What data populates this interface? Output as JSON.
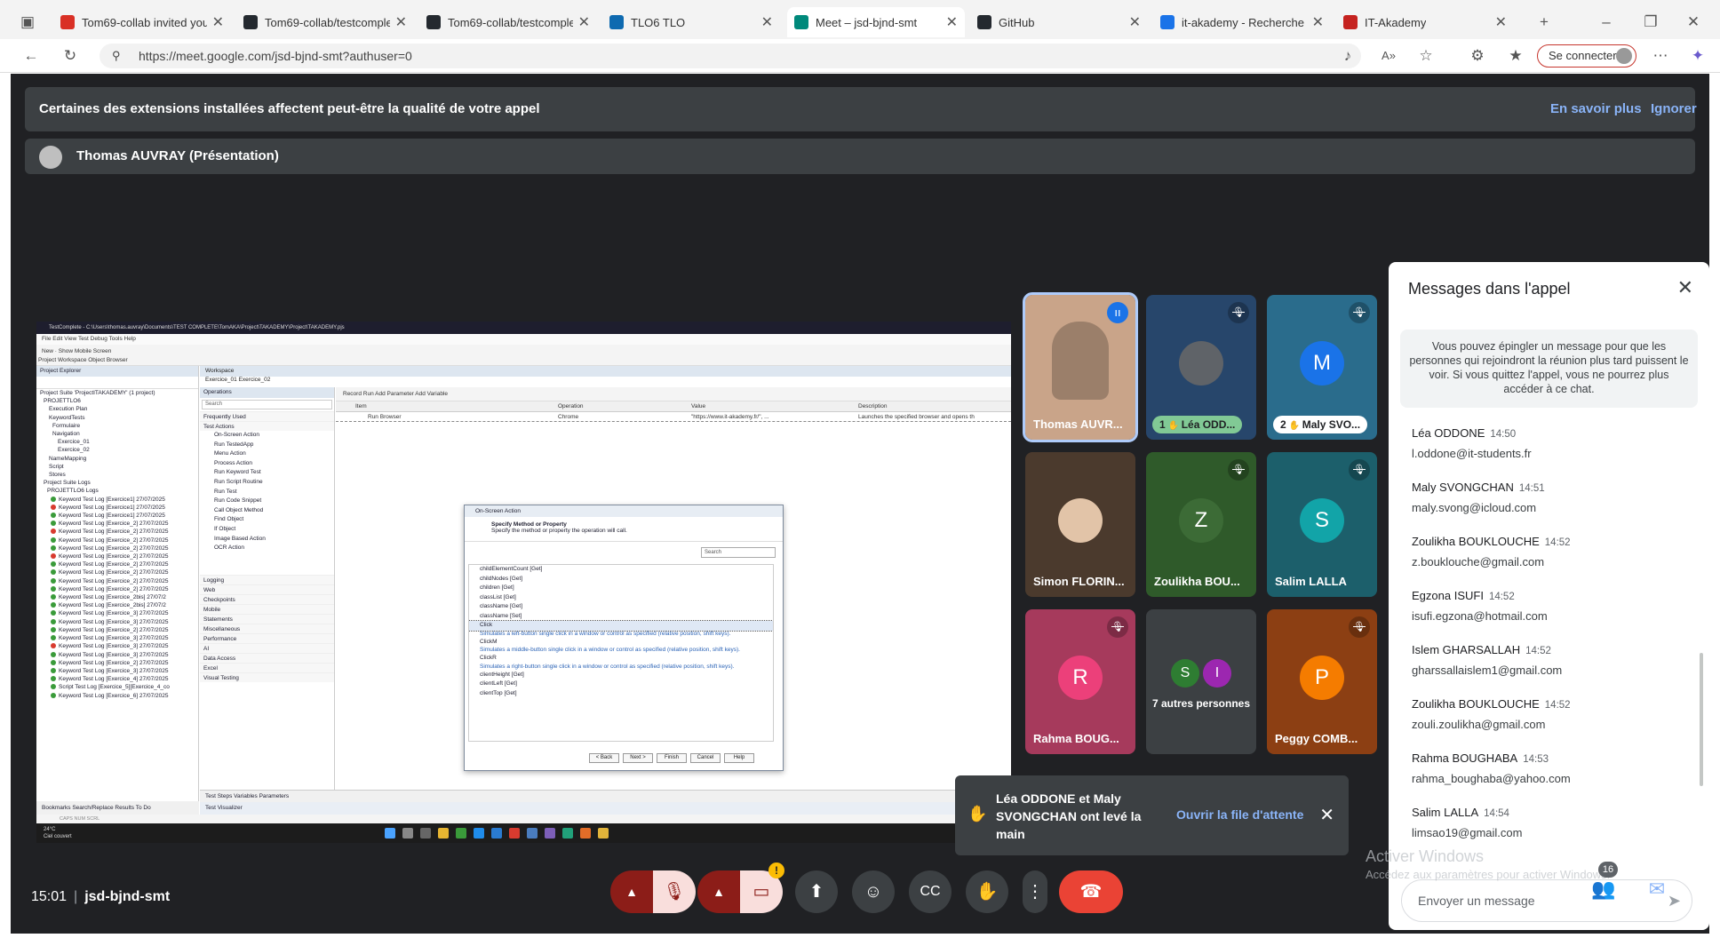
{
  "browser": {
    "tabs": [
      {
        "label": "Tom69-collab invited you t",
        "color": "#d93025"
      },
      {
        "label": "Tom69-collab/testcomplete",
        "color": "#24292f"
      },
      {
        "label": "Tom69-collab/testcomplete",
        "color": "#24292f"
      },
      {
        "label": "TLO6 TLO",
        "color": "#0e6ab0"
      },
      {
        "label": "Meet – jsd-bjnd-smt",
        "color": "#00897b"
      },
      {
        "label": "GitHub",
        "color": "#24292f"
      },
      {
        "label": "it-akademy - Recherche",
        "color": "#1a73e8"
      },
      {
        "label": "IT-Akademy",
        "color": "#c5221f"
      }
    ],
    "url": "https://meet.google.com/jsd-bjnd-smt?authuser=0",
    "connect_label": "Se connecter"
  },
  "banner": {
    "text": "Certaines des extensions installées affectent peut-être la qualité de votre appel",
    "learn_more": "En savoir plus",
    "ignore": "Ignorer"
  },
  "presenter": "Thomas AUVRAY (Présentation)",
  "shared_screen": {
    "window_title": "TestComplete - C:\\Users\\thomas.auvray\\Documents\\TEST COMPLETE\\TomAKA\\Project\\TAKADEMY\\Project\\TAKADEMY.pjs",
    "menu": "File  Edit  View  Test  Debug  Tools  Help",
    "toolbar": "New  ·  Show Mobile Screen",
    "tabs": "Project Workspace   Object Browser",
    "explorer_title": "Project Explorer",
    "workspace_title": "Workspace",
    "tree": [
      {
        "t": "Project Suite 'ProjectITAKADEMY' (1 project)",
        "s": "n"
      },
      {
        "t": "PROJETTLO6",
        "s": "n"
      },
      {
        "t": "Execution Plan",
        "s": "n"
      },
      {
        "t": "KeywordTests",
        "s": "n"
      },
      {
        "t": "Formulaire",
        "s": "n"
      },
      {
        "t": "Navigation",
        "s": "n"
      },
      {
        "t": "Exercice_01",
        "s": "n"
      },
      {
        "t": "Exercice_02",
        "s": "n"
      },
      {
        "t": "NameMapping",
        "s": "n"
      },
      {
        "t": "Script",
        "s": "n"
      },
      {
        "t": "Stores",
        "s": "n"
      },
      {
        "t": "Project Suite Logs",
        "s": "n"
      },
      {
        "t": "PROJETTLO6 Logs",
        "s": "n"
      },
      {
        "t": "Keyword Test Log [Exercice1] 27/07/2025",
        "s": "g"
      },
      {
        "t": "Keyword Test Log [Exercice1] 27/07/2025",
        "s": "r"
      },
      {
        "t": "Keyword Test Log [Exercice1] 27/07/2025",
        "s": "g"
      },
      {
        "t": "Keyword Test Log [Exercice_2] 27/07/2025",
        "s": "g"
      },
      {
        "t": "Keyword Test Log [Exercice_2] 27/07/2025",
        "s": "r"
      },
      {
        "t": "Keyword Test Log [Exercice_2] 27/07/2025",
        "s": "g"
      },
      {
        "t": "Keyword Test Log [Exercice_2] 27/07/2025",
        "s": "g"
      },
      {
        "t": "Keyword Test Log [Exercice_2] 27/07/2025",
        "s": "r"
      },
      {
        "t": "Keyword Test Log [Exercice_2] 27/07/2025",
        "s": "g"
      },
      {
        "t": "Keyword Test Log [Exercice_2] 27/07/2025",
        "s": "g"
      },
      {
        "t": "Keyword Test Log [Exercice_2] 27/07/2025",
        "s": "g"
      },
      {
        "t": "Keyword Test Log [Exercice_2] 27/07/2025",
        "s": "g"
      },
      {
        "t": "Keyword Test Log [Exercice_2bis] 27/07/2",
        "s": "g"
      },
      {
        "t": "Keyword Test Log [Exercice_2bis] 27/07/2",
        "s": "g"
      },
      {
        "t": "Keyword Test Log [Exercice_3] 27/07/2025",
        "s": "g"
      },
      {
        "t": "Keyword Test Log [Exercice_3] 27/07/2025",
        "s": "g"
      },
      {
        "t": "Keyword Test Log [Exercice_2] 27/07/2025",
        "s": "g"
      },
      {
        "t": "Keyword Test Log [Exercice_3] 27/07/2025",
        "s": "g"
      },
      {
        "t": "Keyword Test Log [Exercice_3] 27/07/2025",
        "s": "r"
      },
      {
        "t": "Keyword Test Log [Exercice_3] 27/07/2025",
        "s": "g"
      },
      {
        "t": "Keyword Test Log [Exercice_2] 27/07/2025",
        "s": "g"
      },
      {
        "t": "Keyword Test Log [Exercice_3] 27/07/2025",
        "s": "g"
      },
      {
        "t": "Keyword Test Log [Exercice_4] 27/07/2025",
        "s": "g"
      },
      {
        "t": "Script Test Log [Exercice_5][Exercice_4_co",
        "s": "g"
      },
      {
        "t": "Keyword Test Log [Exercice_6] 27/07/2025",
        "s": "g"
      }
    ],
    "editor_tabs": "Exercice_01   Exercice_02",
    "operations_title": "Operations",
    "ops_search": "Search",
    "ops_top": [
      "Frequently Used",
      "Test Actions"
    ],
    "ops_items": [
      "On-Screen Action",
      "Run TestedApp",
      "Menu Action",
      "Process Action",
      "Run Keyword Test",
      "Run Script Routine",
      "Run Test",
      "Run Code Snippet",
      "Call Object Method",
      "Find Object",
      "If Object",
      "Image Based Action",
      "OCR Action"
    ],
    "ops_cats": [
      "Logging",
      "Web",
      "Checkpoints",
      "Mobile",
      "Statements",
      "Miscellaneous",
      "Performance",
      "AI",
      "Data Access",
      "Excel",
      "Visual Testing"
    ],
    "editor_toolbar": "Record   Run   Add Parameter   Add Variable",
    "grid_cols": [
      "Item",
      "Operation",
      "Value",
      "Description"
    ],
    "grid_row": [
      "Run Browser",
      "Chrome",
      "\"https://www.it-akademy.fr/\", ...",
      "Launches the specified browser and opens th"
    ],
    "dialog": {
      "title": "On-Screen Action",
      "heading": "Specify Method or Property",
      "sub": "Specify the method or property the operation will call.",
      "search": "Search",
      "items": [
        {
          "t": "childElementCount [Get]",
          "d": false
        },
        {
          "t": "childNodes [Get]",
          "d": false
        },
        {
          "t": "children [Get]",
          "d": false
        },
        {
          "t": "classList [Get]",
          "d": false
        },
        {
          "t": "className [Get]",
          "d": false
        },
        {
          "t": "className [Set]",
          "d": false
        },
        {
          "t": "Click",
          "d": false
        },
        {
          "t": "Simulates a left-button single click in a window or control as specified (relative position, shift keys).",
          "d": true
        },
        {
          "t": "ClickM",
          "d": false
        },
        {
          "t": "Simulates a middle-button single click in a window or control as specified (relative position, shift keys).",
          "d": true
        },
        {
          "t": "ClickR",
          "d": false
        },
        {
          "t": "Simulates a right-button single click in a window or control as specified (relative position, shift keys).",
          "d": true
        },
        {
          "t": "clientHeight [Get]",
          "d": false
        },
        {
          "t": "clientLeft [Get]",
          "d": false
        },
        {
          "t": "clientTop [Get]",
          "d": false
        }
      ],
      "buttons": [
        "< Back",
        "Next >",
        "Finish",
        "Cancel",
        "Help"
      ]
    },
    "bottom_tabs": "Test Steps   Variables   Parameters",
    "visualizer": "Test Visualizer",
    "left_bottom": "Bookmarks   Search/Replace Results   To Do",
    "status": "CAPS   NUM   SCRL",
    "weather": [
      "24°C",
      "Ciel couvert"
    ]
  },
  "participants": [
    {
      "name": "Thomas AUVR...",
      "bg": "#c9a489",
      "muted": false,
      "speaking": true
    },
    {
      "name": "Léa ODD...",
      "bg": "#27466b",
      "muted": true,
      "avatar_bg": "#5f6368",
      "letter": "",
      "pill": true,
      "badge": "1"
    },
    {
      "name": "Maly SVO...",
      "bg": "#2a6c8c",
      "muted": true,
      "avatar_bg": "#1a73e8",
      "letter": "M",
      "pill": true,
      "badge": "2"
    },
    {
      "name": "Simon FLORIN...",
      "bg": "#4b3a2d",
      "muted": false,
      "avatar_bg": "#e2c4a8",
      "letter": ""
    },
    {
      "name": "Zoulikha BOU...",
      "bg": "#2f5a2a",
      "muted": true,
      "avatar_bg": "#3c6b36",
      "letter": "Z"
    },
    {
      "name": "Salim LALLA",
      "bg": "#1c5f6b",
      "muted": true,
      "avatar_bg": "#12a4a8",
      "letter": "S"
    },
    {
      "name": "Rahma BOUG...",
      "bg": "#a63a5c",
      "muted": true,
      "avatar_bg": "#ec407a",
      "letter": "R"
    },
    {
      "name": "7 autres personnes",
      "bg": "#3c4043",
      "muted": false,
      "avatar_bg": "#2e7d32",
      "letter": "S",
      "letter2": "I"
    },
    {
      "name": "Peggy COMB...",
      "bg": "#8c3f13",
      "muted": true,
      "avatar_bg": "#f57c00",
      "letter": "P"
    }
  ],
  "chat": {
    "title": "Messages dans l'appel",
    "info": "Vous pouvez épingler un message pour que les personnes qui rejoindront la réunion plus tard puissent le voir. Si vous quittez l'appel, vous ne pourrez plus accéder à ce chat.",
    "messages": [
      {
        "who": "Léa ODDONE",
        "time": "14:50",
        "text": "l.oddone@it-students.fr"
      },
      {
        "who": "Maly SVONGCHAN",
        "time": "14:51",
        "text": "maly.svong@icloud.com"
      },
      {
        "who": "Zoulikha BOUKLOUCHE",
        "time": "14:52",
        "text": "z.bouklouche@gmail.com"
      },
      {
        "who": "Egzona ISUFI",
        "time": "14:52",
        "text": "isufi.egzona@hotmail.com"
      },
      {
        "who": "Islem GHARSALLAH",
        "time": "14:52",
        "text": "gharssallaislem1@gmail.com"
      },
      {
        "who": "Zoulikha BOUKLOUCHE",
        "time": "14:52",
        "text": "zouli.zoulikha@gmail.com"
      },
      {
        "who": "Rahma BOUGHABA",
        "time": "14:53",
        "text": "rahma_boughaba@yahoo.com"
      },
      {
        "who": "Salim LALLA",
        "time": "14:54",
        "text": "limsao19@gmail.com"
      }
    ],
    "placeholder": "Envoyer un message"
  },
  "notification": {
    "text": "Léa ODDONE et Maly SVONGCHAN ont levé la main",
    "action": "Ouvrir la file d'attente"
  },
  "bottom": {
    "time": "15:01",
    "meeting_code": "jsd-bjnd-smt",
    "participant_count": "16",
    "camera_alert": "!"
  },
  "watermark": {
    "line1": "Activer Windows",
    "line2": "Accédez aux paramètres pour activer Windows."
  }
}
